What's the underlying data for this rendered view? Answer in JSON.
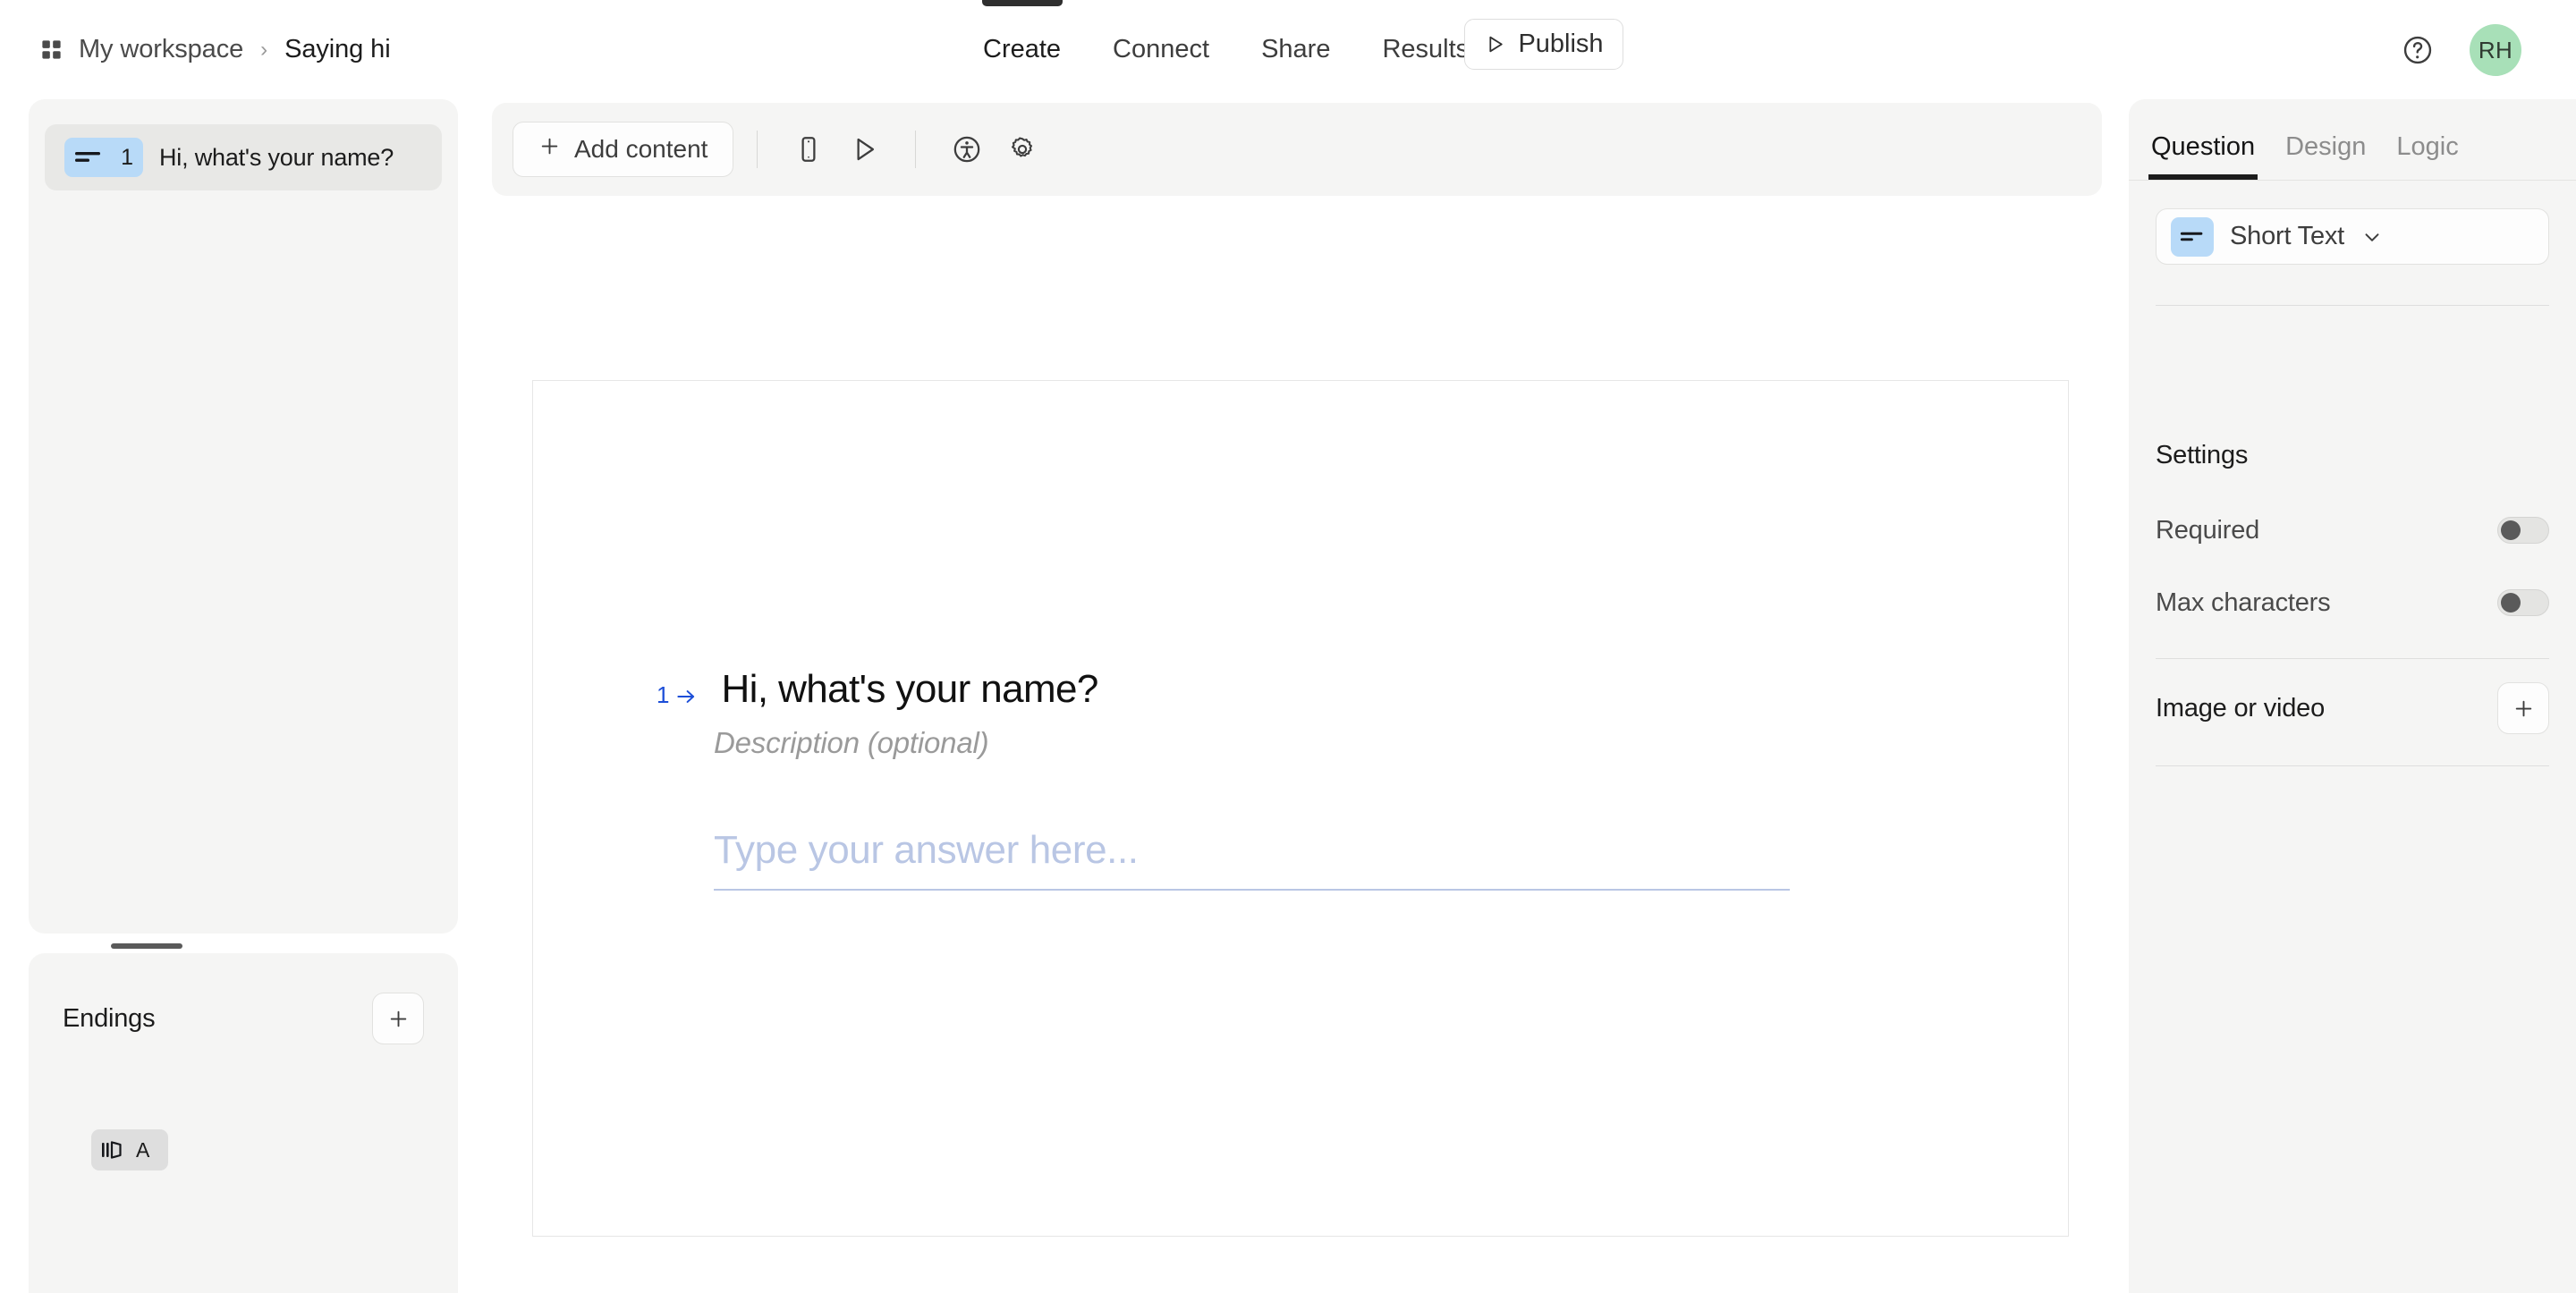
{
  "header": {
    "workspace_icon": "grid-icon",
    "workspace": "My workspace",
    "separator": "›",
    "form_title": "Saying hi",
    "tabs": [
      {
        "label": "Create",
        "active": true
      },
      {
        "label": "Connect",
        "active": false
      },
      {
        "label": "Share",
        "active": false
      },
      {
        "label": "Results",
        "active": false
      }
    ],
    "publish": {
      "label": "Publish",
      "icon": "play-outline-icon"
    },
    "help_icon": "help-circle-icon",
    "avatar": {
      "initials": "RH",
      "color": "#a8e0b8"
    }
  },
  "sidebar": {
    "questions": [
      {
        "type_icon": "short-text-icon",
        "number": "1",
        "title": "Hi, what's your name?",
        "selected": true
      }
    ],
    "endings": {
      "title": "Endings",
      "add_icon": "plus-icon",
      "items": [
        {
          "icon": "exit-door-icon",
          "letter": "A"
        }
      ]
    }
  },
  "toolbar": {
    "add_content": {
      "label": "Add content",
      "icon": "plus-icon"
    },
    "icons": [
      {
        "name": "mobile-preview-icon"
      },
      {
        "name": "play-preview-icon"
      },
      {
        "name": "accessibility-icon"
      },
      {
        "name": "settings-gear-icon"
      }
    ]
  },
  "canvas": {
    "question": {
      "index": "1",
      "arrow_icon": "arrow-right-icon",
      "heading": "Hi, what's your name?",
      "description_placeholder": "Description (optional)",
      "answer_placeholder": "Type your answer here...",
      "accent_color": "#1c4ed8",
      "answer_color": "#b9c6e4"
    }
  },
  "right_panel": {
    "tabs": [
      {
        "label": "Question",
        "active": true
      },
      {
        "label": "Design",
        "active": false
      },
      {
        "label": "Logic",
        "active": false
      }
    ],
    "type_select": {
      "icon": "short-text-icon",
      "value": "Short Text",
      "chevron": "chevron-down-icon"
    },
    "settings": {
      "title": "Settings",
      "rows": [
        {
          "label": "Required",
          "enabled": false
        },
        {
          "label": "Max characters",
          "enabled": false
        }
      ]
    },
    "media": {
      "label": "Image or video",
      "add_icon": "plus-icon"
    }
  }
}
